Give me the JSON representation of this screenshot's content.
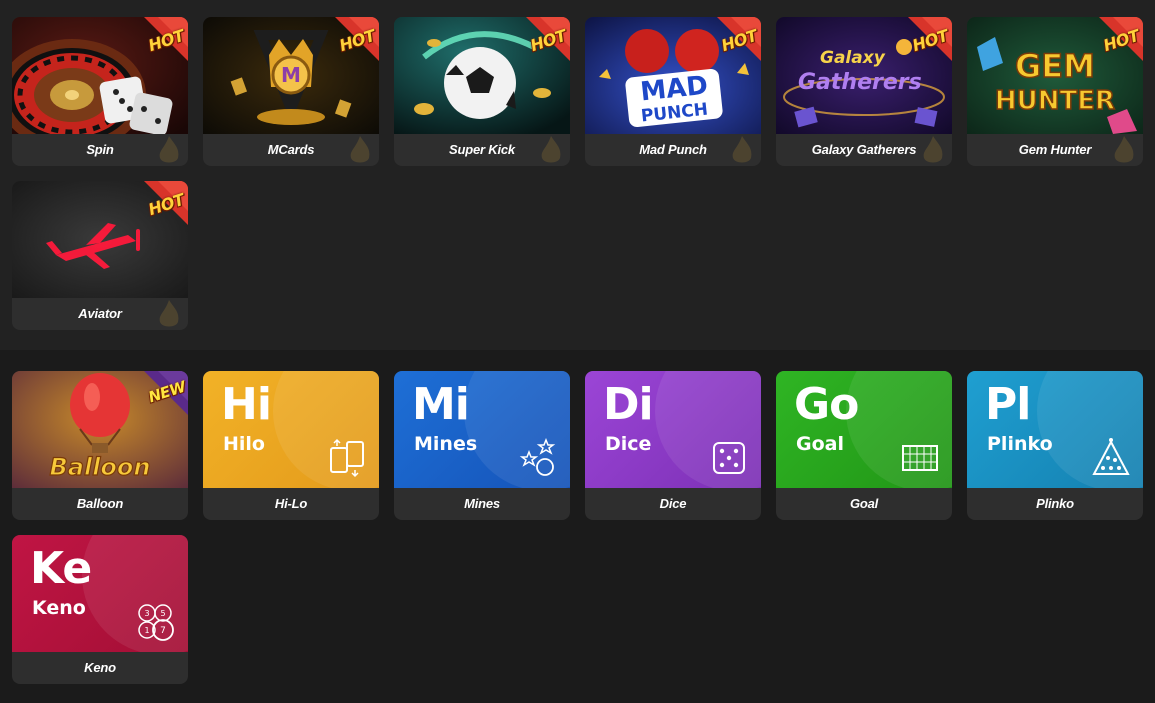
{
  "hot_games": [
    {
      "label": "Spin",
      "badge": "HOT"
    },
    {
      "label": "MCards",
      "badge": "HOT"
    },
    {
      "label": "Super Kick",
      "badge": "HOT"
    },
    {
      "label": "Mad Punch",
      "badge": "HOT",
      "art_text": [
        "MAD",
        "PUNCH"
      ]
    },
    {
      "label": "Galaxy Gatherers",
      "badge": "HOT",
      "art_text": [
        "Galaxy",
        "Gatherers"
      ]
    },
    {
      "label": "Gem Hunter",
      "badge": "HOT",
      "art_text": [
        "GEM",
        "HUNTER"
      ]
    },
    {
      "label": "Aviator",
      "badge": "HOT"
    }
  ],
  "original_games": [
    {
      "label": "Balloon",
      "badge": "NEW",
      "art_text": "Balloon"
    },
    {
      "label": "Hi-Lo",
      "symbol": "Hi",
      "name": "Hilo",
      "color": "#e8a21a",
      "icon": "cards-icon"
    },
    {
      "label": "Mines",
      "symbol": "Mi",
      "name": "Mines",
      "color": "#1b63c9",
      "icon": "stars-bomb-icon"
    },
    {
      "label": "Dice",
      "symbol": "Di",
      "name": "Dice",
      "color": "#8e3cc8",
      "icon": "dice-icon"
    },
    {
      "label": "Goal",
      "symbol": "Go",
      "name": "Goal",
      "color": "#27a31c",
      "icon": "goal-net-icon"
    },
    {
      "label": "Plinko",
      "symbol": "Pl",
      "name": "Plinko",
      "color": "#1a90c2",
      "icon": "plinko-pyramid-icon"
    },
    {
      "label": "Keno",
      "symbol": "Ke",
      "name": "Keno",
      "color": "#b5123a",
      "icon": "keno-balls-icon",
      "icon_numbers": [
        "3",
        "5",
        "1",
        "7"
      ]
    }
  ]
}
